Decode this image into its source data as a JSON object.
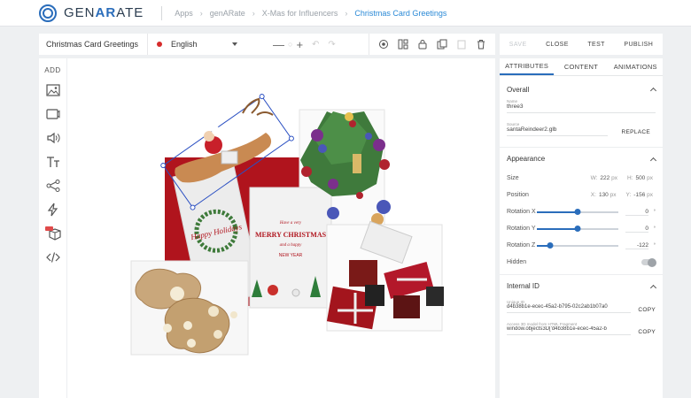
{
  "header": {
    "logo_prefix": "GEN",
    "logo_brand": "AR",
    "logo_suffix": "ATE",
    "breadcrumbs": [
      "Apps",
      "genARate",
      "X-Mas for Influencers",
      "Christmas Card Greetings"
    ]
  },
  "editor": {
    "document_title": "Christmas Card Greetings",
    "language": "English",
    "language_color": "#d62b2b",
    "zoom_out": "—",
    "zoom_in": "+"
  },
  "actions": {
    "save": "SAVE",
    "close": "CLOSE",
    "test": "TEST",
    "publish": "PUBLISH"
  },
  "rail": {
    "add_label": "ADD",
    "tools": [
      "image-icon",
      "video-icon",
      "audio-icon",
      "text-icon",
      "share-icon",
      "trigger-icon",
      "3d-object-icon",
      "code-icon"
    ]
  },
  "canvas": {
    "card_greeting": "Happy Holidays",
    "card_headline_top": "Have a very",
    "card_headline": "MERRY CHRISTMAS",
    "card_subline": "and a happy",
    "card_footer": "NEW YEAR"
  },
  "panel": {
    "tabs": [
      "ATTRIBUTES",
      "CONTENT",
      "ANIMATIONS"
    ],
    "active_tab": "ATTRIBUTES",
    "overall": {
      "title": "Overall",
      "name_label": "Name",
      "name_value": "three3",
      "source_label": "Source",
      "source_value": "santaReindeer2.glb",
      "replace": "REPLACE"
    },
    "appearance": {
      "title": "Appearance",
      "size_label": "Size",
      "size_w_axis": "W:",
      "size_w": "222",
      "size_h_axis": "H:",
      "size_h": "500",
      "unit": "px",
      "position_label": "Position",
      "pos_x_axis": "X:",
      "pos_x": "130",
      "pos_y_axis": "Y:",
      "pos_y": "-156",
      "rot_x_label": "Rotation X",
      "rot_x": "0",
      "rot_y_label": "Rotation Y",
      "rot_y": "0",
      "rot_z_label": "Rotation Z",
      "rot_z": "-122",
      "deg": "°",
      "hidden_label": "Hidden"
    },
    "internal": {
      "title": "Internal ID",
      "unique_label": "Unique ID",
      "unique_value": "d4b38b1e-ecec-45a2-b795-02c2ab1b07a0",
      "access_label": "Access 3D model from HTML Fragment",
      "access_value": "window.objects3D['d4b38b1e-ecec-45a2-b",
      "copy": "COPY"
    }
  }
}
